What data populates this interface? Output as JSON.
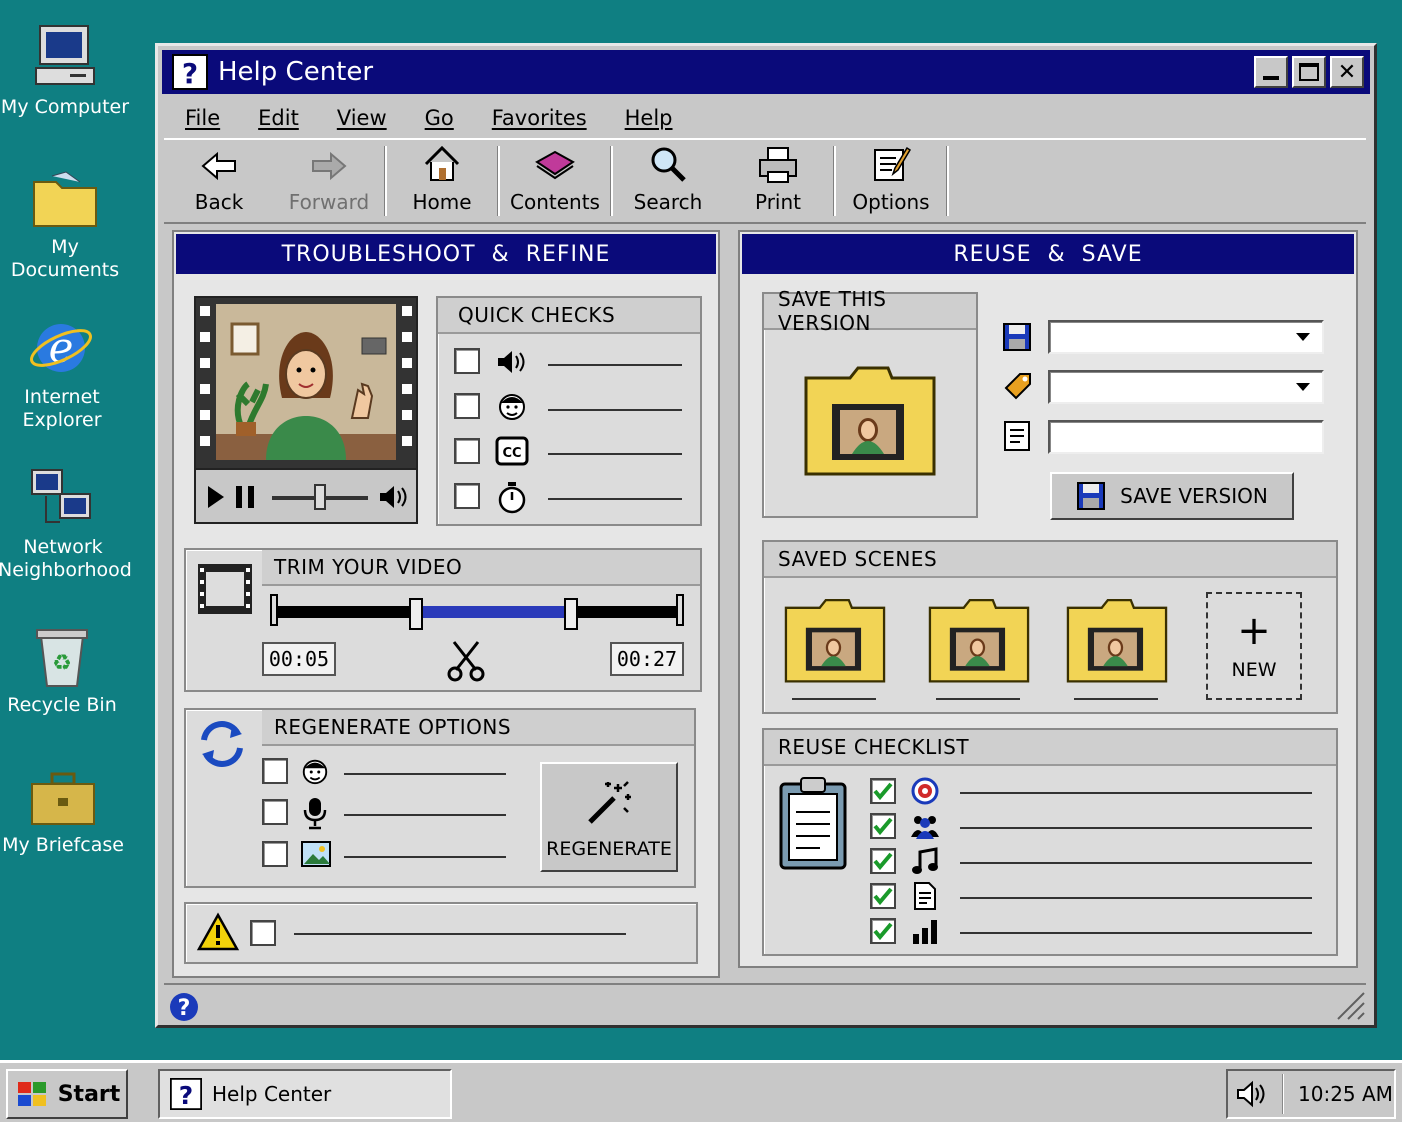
{
  "desktop": {
    "icons": [
      {
        "label": "My Computer"
      },
      {
        "label": "My Documents"
      },
      {
        "label": "Internet Explorer"
      },
      {
        "label": "Network Neighborhood"
      },
      {
        "label": "Recycle Bin"
      },
      {
        "label": "My Briefcase"
      }
    ]
  },
  "window": {
    "title": "Help Center"
  },
  "menu": [
    "File",
    "Edit",
    "View",
    "Go",
    "Favorites",
    "Help"
  ],
  "toolbar": {
    "back": "Back",
    "forward": "Forward",
    "home": "Home",
    "contents": "Contents",
    "search": "Search",
    "print": "Print",
    "options": "Options"
  },
  "left": {
    "title": "TROUBLESHOOT  &  REFINE",
    "quick_checks": {
      "title": "QUICK CHECKS",
      "items": [
        {
          "icon": "speaker-icon"
        },
        {
          "icon": "face-icon"
        },
        {
          "icon": "cc-icon"
        },
        {
          "icon": "stopwatch-icon"
        }
      ]
    },
    "trim": {
      "title": "TRIM YOUR VIDEO",
      "start": "00:05",
      "end": "00:27",
      "range": [
        0.35,
        0.73
      ]
    },
    "regen": {
      "title": "REGENERATE OPTIONS",
      "button": "REGENERATE"
    }
  },
  "right": {
    "title": "REUSE  &  SAVE",
    "save": {
      "title": "SAVE THIS VERSION",
      "button": "SAVE VERSION"
    },
    "scenes": {
      "title": "SAVED SCENES",
      "new_label": "NEW"
    },
    "checklist": {
      "title": "REUSE CHECKLIST",
      "items": [
        {
          "icon": "target-icon"
        },
        {
          "icon": "people-icon"
        },
        {
          "icon": "music-icon"
        },
        {
          "icon": "document-icon"
        },
        {
          "icon": "bar-chart-icon"
        }
      ]
    }
  },
  "taskbar": {
    "start": "Start",
    "task": "Help Center",
    "clock": "10:25 AM"
  },
  "colors": {
    "desktop": "#0f7f82",
    "titlebar": "#0a0a7a",
    "folder": "#f2d455"
  }
}
